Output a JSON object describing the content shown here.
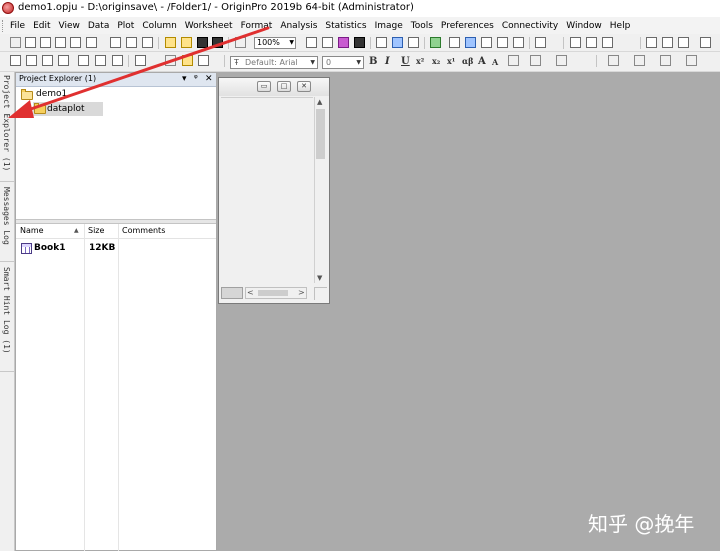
{
  "window": {
    "title": "demo1.opju - D:\\originsave\\ - /Folder1/ - OriginPro 2019b 64-bit (Administrator)"
  },
  "menu": [
    "File",
    "Edit",
    "View",
    "Data",
    "Plot",
    "Column",
    "Worksheet",
    "Format",
    "Analysis",
    "Statistics",
    "Image",
    "Tools",
    "Preferences",
    "Connectivity",
    "Window",
    "Help"
  ],
  "toolbar": {
    "zoom_value": "100%",
    "font_name": "Default: Arial",
    "font_size": "0",
    "format_glyphs": [
      "B",
      "I",
      "U",
      "x²",
      "x₂",
      "x¹",
      "αβ",
      "A",
      "A"
    ]
  },
  "side_tabs": [
    "Project Explorer (1)",
    "Messages Log",
    "Smart Hint Log (1)"
  ],
  "project_explorer": {
    "title": "Project Explorer (1)",
    "controls": [
      "▾",
      "ᵠ",
      "✕"
    ],
    "tree": {
      "root": "demo1",
      "child": "dataplot"
    },
    "columns": [
      "Name",
      "Size",
      "Comments"
    ],
    "rows": [
      {
        "name": "Book1",
        "size": "12KB",
        "comments": ""
      }
    ]
  },
  "child_window": {
    "buttons": [
      "▭",
      "□",
      "✕"
    ],
    "scroll": {
      "up": "▲",
      "down": "▼",
      "left": "<",
      "right": ">"
    }
  },
  "annotation_color": "#e03030",
  "watermark": "知乎 @挽年"
}
